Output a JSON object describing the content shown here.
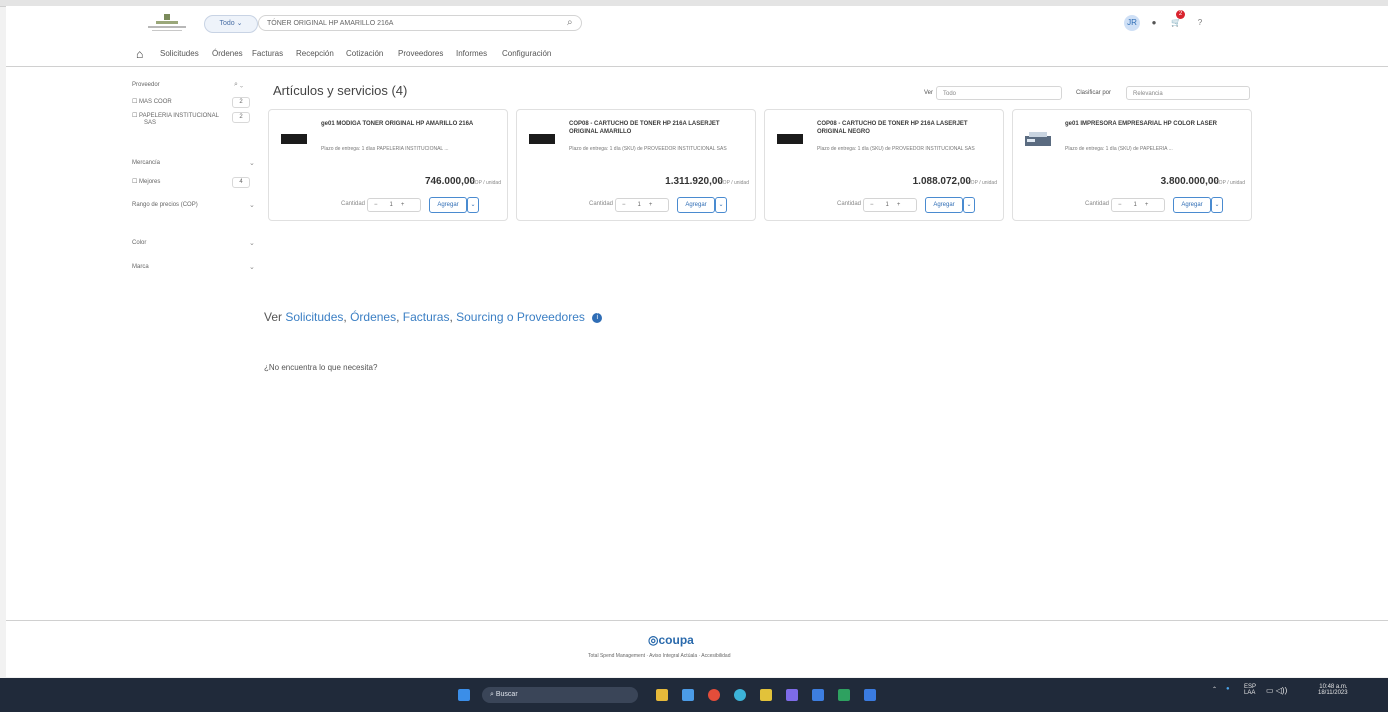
{
  "header": {
    "search_scope": "Todo ⌄",
    "search_value": "TÓNER ORIGINAL HP AMARILLO 216A",
    "search_placeholder": "Buscar",
    "user_initials": "JR",
    "cart_count": "2"
  },
  "nav": {
    "items": [
      "Solicitudes",
      "Órdenes",
      "Facturas",
      "Recepción",
      "Cotización",
      "Proveedores",
      "Informes",
      "Configuración"
    ]
  },
  "sidebar": {
    "proveedor": "Proveedor",
    "filters": [
      {
        "label": "MAS COOR",
        "count": "2"
      },
      {
        "label": "PAPELERIA INSTITUCIONAL",
        "label2": "SAS",
        "count": "2"
      }
    ],
    "marcas": "Mercancía",
    "marca_filters": [
      {
        "label": "Mejores",
        "count": "4"
      }
    ],
    "price_range": "Rango de precios (COP)",
    "color": "Color",
    "marca": "Marca"
  },
  "main": {
    "title": "Artículos y servicios (4)",
    "ver_label": "Ver",
    "ver_value": "Todo",
    "sort_label": "Clasificar por",
    "sort_value": "Relevancia",
    "qty_label": "Cantidad",
    "add_label": "Agregar",
    "cards": [
      {
        "title": "ge01 MODIGA TONER ORIGINAL HP AMARILLO 216A",
        "sub": "Plazo de entrega: 1 días PAPELERIA INSTITUCIONAL ...",
        "price": "746.000,00",
        "currency": "COP / unidad",
        "qty": "1"
      },
      {
        "title": "COP08 - CARTUCHO DE TONER HP 216A LASERJET ORIGINAL AMARILLO",
        "sub": "Plazo de entrega: 1 día (SKU) de PROVEEDOR INSTITUCIONAL SAS",
        "price": "1.311.920,00",
        "currency": "COP / unidad",
        "qty": "1"
      },
      {
        "title": "COP08 - CARTUCHO DE TONER HP 216A LASERJET ORIGINAL NEGRO",
        "sub": "Plazo de entrega: 1 día (SKU) de PROVEEDOR INSTITUCIONAL SAS",
        "price": "1.088.072,00",
        "currency": "COP / unidad",
        "qty": "1"
      },
      {
        "title": "ge01 IMPRESORA EMPRESARIAL HP COLOR LASER",
        "sub": "Plazo de entrega: 1 día (SKU) de PAPELERIA ...",
        "price": "3.800.000,00",
        "currency": "COP / unidad",
        "qty": "1"
      }
    ],
    "ver_prefix": "Ver",
    "ver_links": [
      "Solicitudes",
      "Órdenes",
      "Facturas",
      "Sourcing o Proveedores"
    ],
    "not_found": "¿No encuentra lo que necesita?"
  },
  "footer": {
    "brand": "coupa",
    "text": "Total Spend Management · Aviso Integral Actúala · Accesibilidad"
  },
  "taskbar": {
    "search": "Buscar",
    "lang": "ESP",
    "lang2": "LAA",
    "time": "10:48 a.m.",
    "date": "18/11/2023"
  },
  "colors": {
    "accent": "#2f6db5",
    "taskbar": "#202a3a",
    "link": "#3b7fc4"
  }
}
